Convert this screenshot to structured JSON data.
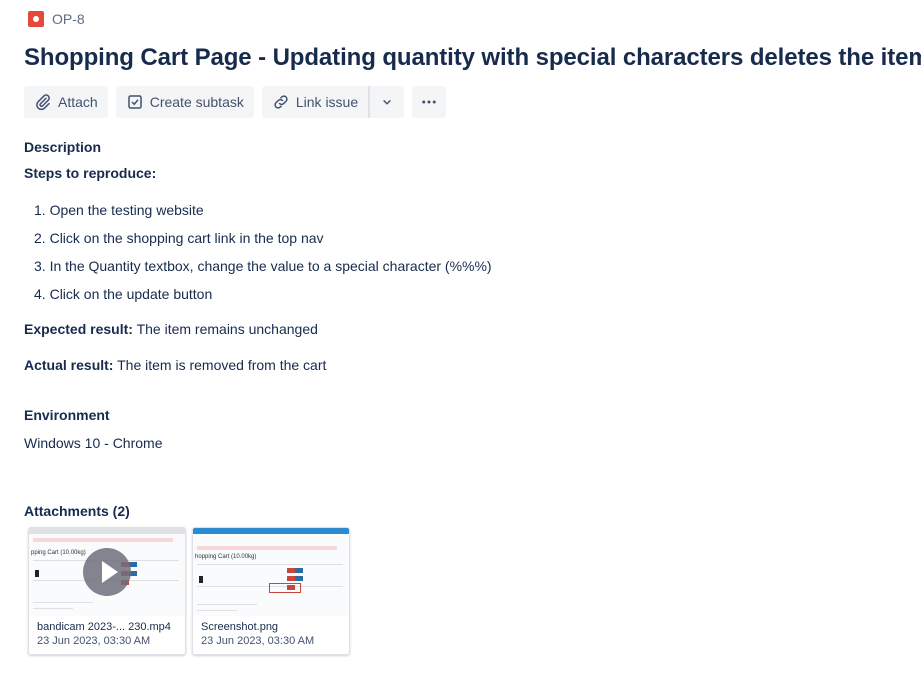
{
  "issue": {
    "key": "OP-8",
    "title": "Shopping Cart Page - Updating quantity with special characters deletes the item"
  },
  "toolbar": {
    "attach_label": "Attach",
    "subtask_label": "Create subtask",
    "link_label": "Link issue"
  },
  "description": {
    "label": "Description",
    "steps_heading": "Steps to reproduce:",
    "steps": [
      "Open the testing website",
      "Click on the shopping cart link in the top nav",
      "In the Quantity textbox, change the value to a special character (%%%)",
      "Click on the update button"
    ],
    "step_numbers": [
      "1.",
      "2.",
      "3.",
      "4."
    ],
    "expected_label": "Expected result:",
    "expected_value": "The item remains unchanged",
    "actual_label": "Actual result:",
    "actual_value": "The item is removed from the cart"
  },
  "environment": {
    "label": "Environment",
    "value": "Windows 10 - Chrome"
  },
  "attachments": {
    "label": "Attachments (2)",
    "items": [
      {
        "name": "bandicam 2023-... 230.mp4",
        "date": "23 Jun 2023, 03:30 AM",
        "thumb_title": "pping Cart (10.00kg)"
      },
      {
        "name": "Screenshot.png",
        "date": "23 Jun 2023, 03:30 AM",
        "thumb_title": "hopping Cart (10.00kg)"
      }
    ]
  },
  "colors": {
    "bug": "#e5493a",
    "button_bg": "#f4f5f7",
    "text": "#172b4d"
  }
}
